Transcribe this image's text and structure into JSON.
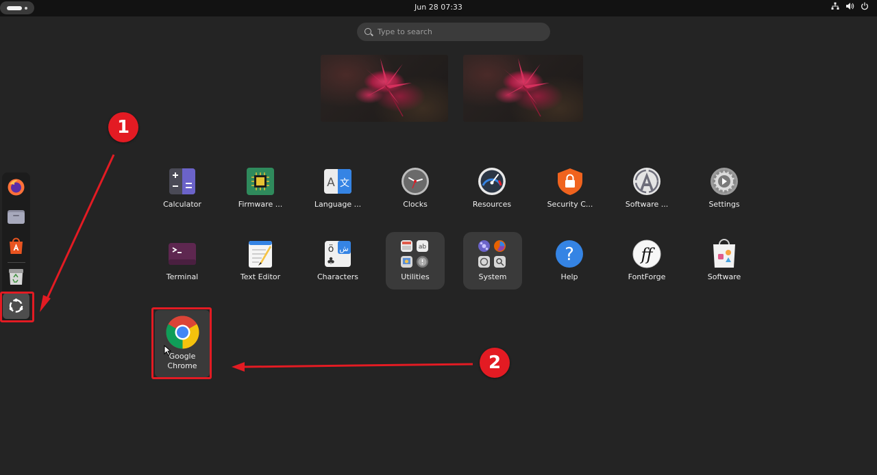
{
  "topbar": {
    "clock": "Jun 28  07:33",
    "tray_icons": [
      "network-icon",
      "volume-icon",
      "power-icon"
    ]
  },
  "search": {
    "placeholder": "Type to search"
  },
  "dock": {
    "items": [
      {
        "name": "Firefox",
        "icon": "firefox-icon"
      },
      {
        "name": "Files",
        "icon": "files-icon"
      },
      {
        "name": "App Center",
        "icon": "app-center-icon"
      },
      {
        "name": "Trash",
        "icon": "trash-icon"
      },
      {
        "name": "Show Apps",
        "icon": "show-apps-icon"
      }
    ]
  },
  "app_grid": {
    "row1": [
      {
        "label": "Calculator",
        "icon": "calculator-icon"
      },
      {
        "label": "Firmware ...",
        "icon": "firmware-icon"
      },
      {
        "label": "Language ...",
        "icon": "language-icon"
      },
      {
        "label": "Clocks",
        "icon": "clocks-icon"
      },
      {
        "label": "Resources",
        "icon": "resources-icon"
      },
      {
        "label": "Security C...",
        "icon": "security-icon"
      },
      {
        "label": "Software ...",
        "icon": "software-updater-icon"
      },
      {
        "label": "Settings",
        "icon": "settings-icon"
      }
    ],
    "row2": [
      {
        "label": "Terminal",
        "icon": "terminal-icon"
      },
      {
        "label": "Text Editor",
        "icon": "text-editor-icon"
      },
      {
        "label": "Characters",
        "icon": "characters-icon"
      },
      {
        "label": "Utilities",
        "icon": "utilities-folder-icon"
      },
      {
        "label": "System",
        "icon": "system-folder-icon"
      },
      {
        "label": "Help",
        "icon": "help-icon"
      },
      {
        "label": "FontForge",
        "icon": "fontforge-icon"
      },
      {
        "label": "Software",
        "icon": "software-icon"
      }
    ],
    "row3": [
      {
        "label_line1": "Google",
        "label_line2": "Chrome",
        "icon": "chrome-icon"
      }
    ]
  },
  "annotations": {
    "badge1": "1",
    "badge2": "2",
    "highlight_color": "#e31b23"
  },
  "colors": {
    "background": "#242424",
    "topbar": "#121212",
    "folder_bg": "#3a3a3a"
  }
}
